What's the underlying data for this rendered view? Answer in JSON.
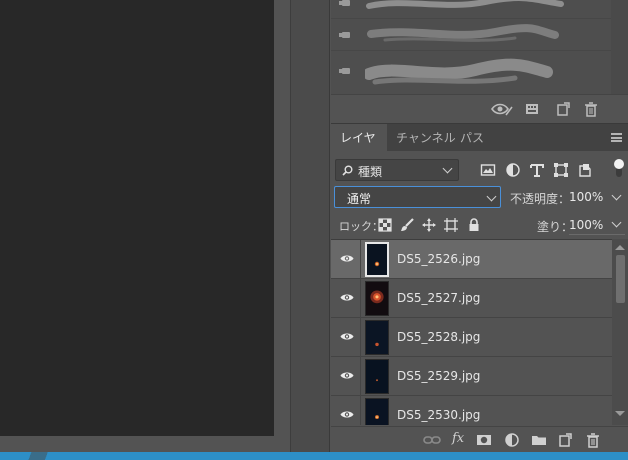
{
  "panel_tabs": [
    {
      "label": "レイヤー",
      "active": true
    },
    {
      "label": "チャンネル",
      "active": false
    },
    {
      "label": "パス",
      "active": false
    }
  ],
  "filter": {
    "kind_label": "種類"
  },
  "blend": {
    "mode": "通常",
    "opacity_label": "不透明度：",
    "opacity_value": "100%"
  },
  "lock": {
    "label": "ロック：",
    "fill_label": "塗り：",
    "fill_value": "100%"
  },
  "layers": [
    {
      "name": "DS5_2526.jpg",
      "selected": true
    },
    {
      "name": "DS5_2527.jpg",
      "selected": false
    },
    {
      "name": "DS5_2528.jpg",
      "selected": false
    },
    {
      "name": "DS5_2529.jpg",
      "selected": false
    },
    {
      "name": "DS5_2530.jpg",
      "selected": false
    }
  ],
  "colors": {
    "accent": "#4a90d9",
    "taskbar": "#2d8fc7",
    "panel_bg": "#535353",
    "selected_row": "#696969"
  }
}
